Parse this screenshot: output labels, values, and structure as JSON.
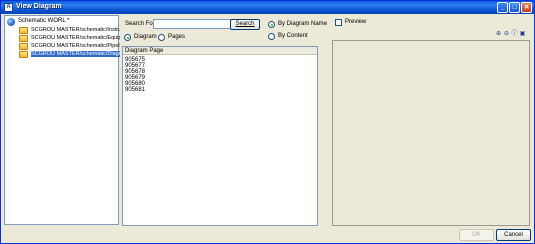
{
  "window": {
    "title": "View Diagram",
    "app_icon": "A"
  },
  "tree": {
    "root_label": "Schematic WORL *",
    "items": [
      {
        "label": "SCGROU MASTER/schematic/Instru",
        "selected": false
      },
      {
        "label": "SCGROU MASTER/schematic/Equip",
        "selected": false
      },
      {
        "label": "SCGROU MASTER/schematic/Pipeli",
        "selected": false
      },
      {
        "label": "SCGROU MASTER/schematic/Diagr",
        "selected": true
      }
    ]
  },
  "search": {
    "label": "Search For",
    "value": "",
    "button_label": "Search",
    "scope_diagram": "Diagram",
    "scope_pages": "Pages",
    "by_name": "By Diagram Name",
    "by_content": "By Content"
  },
  "list": {
    "header": "Diagram Page",
    "rows": [
      "905675",
      "905677",
      "905678",
      "905679",
      "905680",
      "905681"
    ]
  },
  "preview": {
    "label": "Preview",
    "checked": false
  },
  "buttons": {
    "ok": "OK",
    "cancel": "Cancel"
  }
}
